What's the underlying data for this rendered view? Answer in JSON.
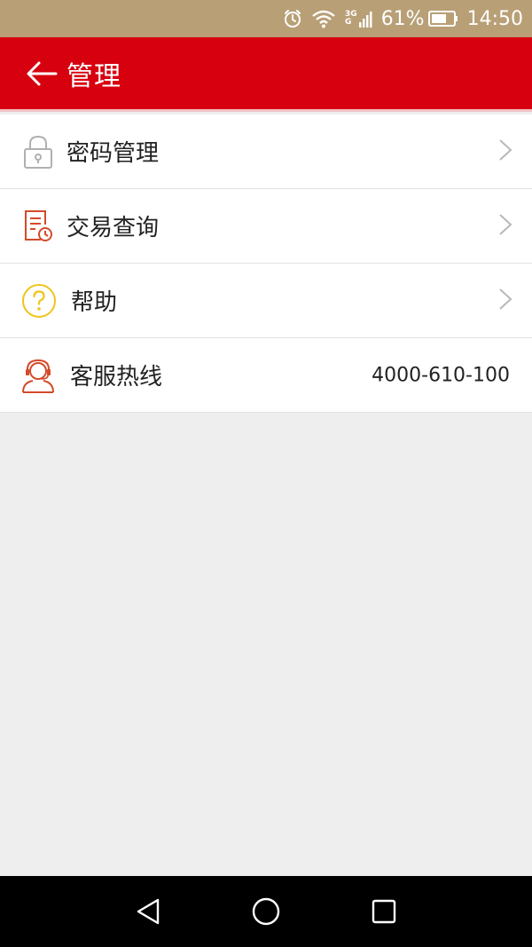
{
  "status_bar": {
    "network_type_top": "3G",
    "network_type_bottom": "G",
    "battery_percent": "61%",
    "time": "14:50",
    "icons": [
      "alarm-icon",
      "wifi-icon",
      "signal-icon",
      "battery-icon"
    ]
  },
  "header": {
    "title": "管理",
    "back_icon": "back-arrow-icon"
  },
  "menu": {
    "items": [
      {
        "label": "密码管理",
        "icon": "lock-icon",
        "has_chevron": true
      },
      {
        "label": "交易查询",
        "icon": "transaction-record-icon",
        "has_chevron": true
      },
      {
        "label": "帮助",
        "icon": "help-icon",
        "has_chevron": true
      },
      {
        "label": "客服热线",
        "icon": "customer-service-icon",
        "value": "4000-610-100",
        "has_chevron": false
      }
    ]
  },
  "nav_bar": {
    "icons": [
      "back-nav-icon",
      "home-nav-icon",
      "recents-nav-icon"
    ]
  },
  "colors": {
    "status_bar": "#b89f76",
    "app_bar": "#d7000f",
    "background": "#eeeeee",
    "help_icon": "#f0c419",
    "accent_icon": "#d44a2a"
  }
}
